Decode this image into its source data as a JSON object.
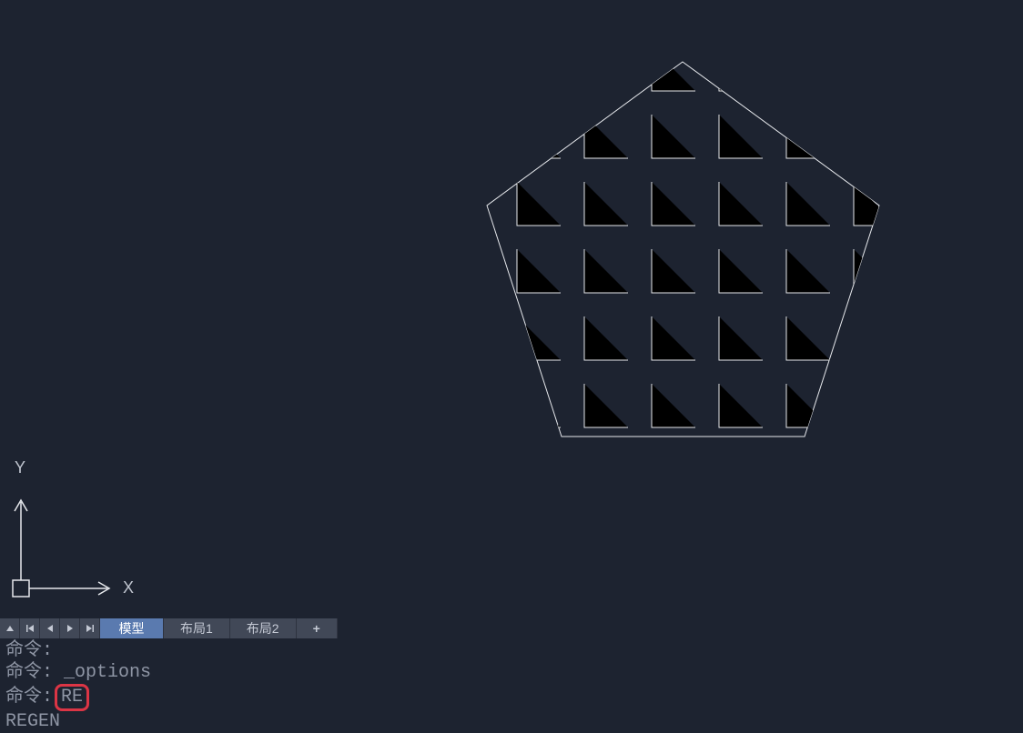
{
  "ucs": {
    "x_label": "X",
    "y_label": "Y"
  },
  "tabs": {
    "model": "模型",
    "layout1": "布局1",
    "layout2": "布局2",
    "add": "+"
  },
  "command_history": {
    "prompt": "命令:",
    "line1_cmd": "",
    "line2_cmd": "_options",
    "line3_cmd_highlight": "RE",
    "line4": "REGEN"
  },
  "drawing": {
    "type": "pentagon_with_hatch",
    "comment": "Pentagon outline with angular (L-shaped) hatch pattern fill, white lines on dark background"
  }
}
